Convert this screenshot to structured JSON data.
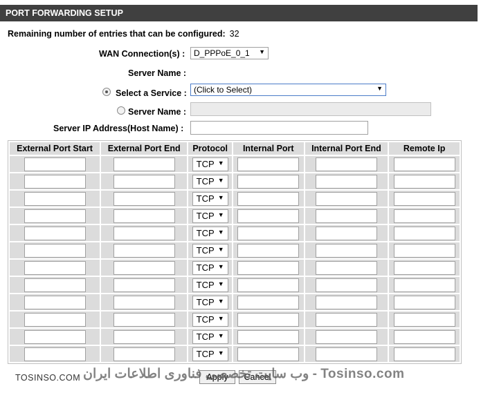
{
  "header": {
    "title": "PORT FORWARDING SETUP"
  },
  "remaining": {
    "label": "Remaining number of entries that can be configured:",
    "count": "32"
  },
  "wan": {
    "label": "WAN Connection(s) :",
    "value": "D_PPPoE_0_1"
  },
  "server_name": {
    "label": "Server Name :"
  },
  "service": {
    "label": "Select a Service :",
    "value": "(Click to Select)",
    "selected": true
  },
  "custom_server": {
    "label": "Server Name :",
    "selected": false
  },
  "server_ip": {
    "label": "Server IP Address(Host Name) :"
  },
  "table": {
    "headers": [
      "External Port Start",
      "External Port End",
      "Protocol",
      "Internal Port",
      "Internal Port End",
      "Remote Ip"
    ],
    "rows": [
      {
        "protocol": "TCP"
      },
      {
        "protocol": "TCP"
      },
      {
        "protocol": "TCP"
      },
      {
        "protocol": "TCP"
      },
      {
        "protocol": "TCP"
      },
      {
        "protocol": "TCP"
      },
      {
        "protocol": "TCP"
      },
      {
        "protocol": "TCP"
      },
      {
        "protocol": "TCP"
      },
      {
        "protocol": "TCP"
      },
      {
        "protocol": "TCP"
      },
      {
        "protocol": "TCP"
      }
    ]
  },
  "buttons": {
    "apply": "Apply",
    "cancel": "Cancel"
  },
  "watermark": {
    "left": "TOSINSO.COM",
    "main": "وب سایت تخصصی فناوری اطلاعات ایران - Tosinso.com"
  },
  "icons": {
    "dropdown": "chevron-down-icon"
  }
}
